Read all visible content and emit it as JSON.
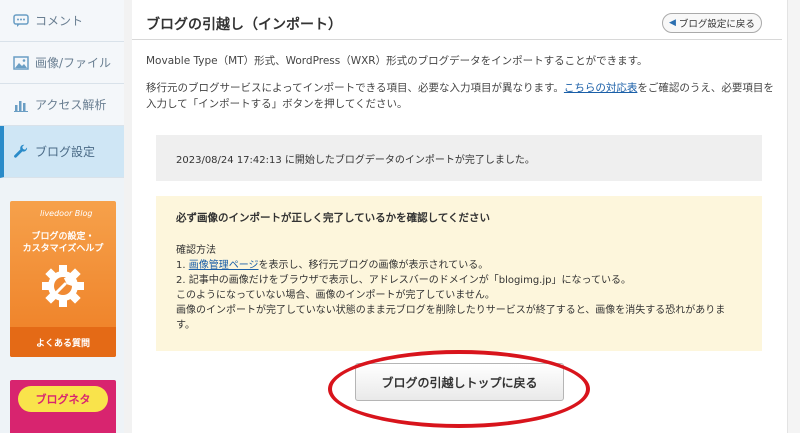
{
  "sidebar": {
    "items": [
      {
        "label": "コメント",
        "icon": "comment-icon"
      },
      {
        "label": "画像/ファイル",
        "icon": "image-icon"
      },
      {
        "label": "アクセス解析",
        "icon": "bar-chart-icon"
      },
      {
        "label": "ブログ設定",
        "icon": "wrench-icon"
      }
    ],
    "active_index": 3,
    "banner_help": {
      "brand": "livedoor Blog",
      "title_line1": "ブログの設定・",
      "title_line2": "カスタマイズヘルプ",
      "faq": "よくある質問"
    },
    "banner_neta": {
      "label": "ブログネタ"
    }
  },
  "header": {
    "title": "ブログの引越し（インポート）",
    "back_button": "ブログ設定に戻る"
  },
  "main": {
    "desc1": "Movable Type（MT）形式、WordPress（WXR）形式のブログデータをインポートすることができます。",
    "desc2_before": "移行元のブログサービスによってインポートできる項目、必要な入力項目が異なります。",
    "desc2_link": "こちらの対応表",
    "desc2_after": "をご確認のうえ、必要項目を入力して「インポートする」ボタンを押してください。",
    "status": "2023/08/24 17:42:13 に開始したブログデータのインポートが完了しました。",
    "warning": {
      "title": "必ず画像のインポートが正しく完了しているかを確認してください",
      "method_label": "確認方法",
      "step1_prefix": "1. ",
      "step1_link": "画像管理ページ",
      "step1_after": "を表示し、移行元ブログの画像が表示されている。",
      "step2": "2. 記事中の画像だけをブラウザで表示し、アドレスバーのドメインが「blogimg.jp」になっている。",
      "line3": "このようになっていない場合、画像のインポートが完了していません。",
      "line4": "画像のインポートが完了していない状態のまま元ブログを削除したりサービスが終了すると、画像を消失する恐れがあります。"
    },
    "top_button": "ブログの引越しトップに戻る"
  },
  "colors": {
    "accent": "#2a8bc9",
    "highlight_circle": "#d8141c",
    "warning_bg": "#fdf6dc",
    "link": "#1a5fa8"
  }
}
